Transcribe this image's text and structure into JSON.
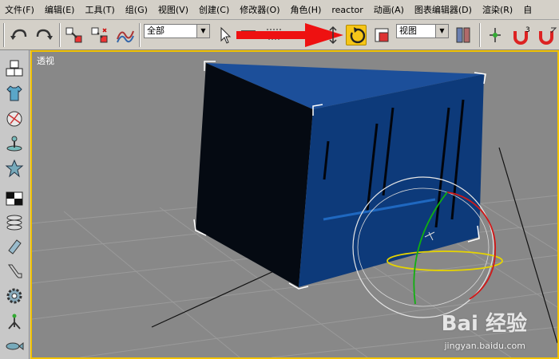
{
  "menu": [
    "文件(F)",
    "编辑(E)",
    "工具(T)",
    "组(G)",
    "视图(V)",
    "创建(C)",
    "修改器(O)",
    "角色(H)",
    "reactor",
    "动画(A)",
    "图表编辑器(D)",
    "渲染(R)",
    "自"
  ],
  "toolbar": {
    "selection_filter": "全部",
    "reference_coord": "视图",
    "active_tool": "select-and-rotate",
    "active_color": "#f5c518",
    "snap_label": "3"
  },
  "viewport": {
    "label": "透视",
    "border_color": "#f2c200",
    "object_color": "#0d3a7a"
  },
  "watermark": {
    "brand": "Bai 经验",
    "url": "jingyan.baidu.com"
  }
}
